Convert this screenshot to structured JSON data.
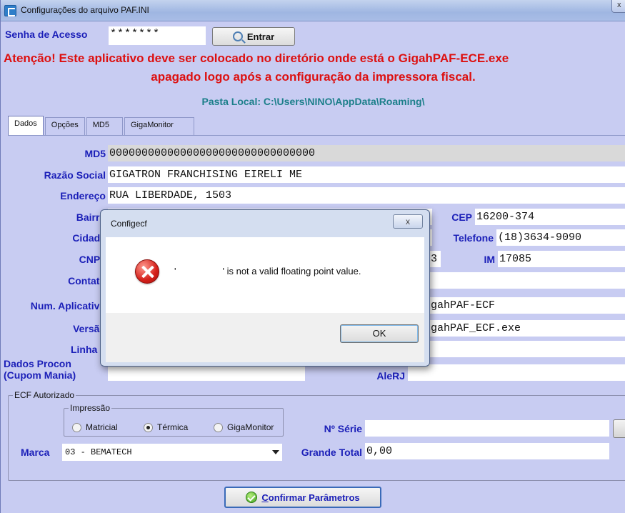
{
  "window": {
    "title": "Configurações do arquivo PAF.INI",
    "close_glyph": "x"
  },
  "login": {
    "label": "Senha de Acesso",
    "password_value": "*******",
    "enter_label": "Entrar"
  },
  "warning": {
    "line1": "Atenção! Este aplicativo deve ser colocado no diretório onde está o GigahPAF-ECE.exe",
    "line2": "apagado logo após a configuração da impressora fiscal."
  },
  "local_path": "Pasta Local: C:\\Users\\NINO\\AppData\\Roaming\\",
  "tabs": [
    {
      "label": "Dados",
      "active": true
    },
    {
      "label": "Opções",
      "active": false
    },
    {
      "label": "MD5",
      "active": false
    },
    {
      "label": "GigaMonitor",
      "active": false
    }
  ],
  "form": {
    "md5": {
      "label": "MD5",
      "value": "00000000000000000000000000000000"
    },
    "razao_social": {
      "label": "Razão Social",
      "value": "GIGATRON FRANCHISING EIRELI ME"
    },
    "endereco": {
      "label": "Endereço",
      "value": "RUA LIBERDADE, 1503"
    },
    "bairro": {
      "label": "Bairro"
    },
    "cep": {
      "label": "CEP",
      "value": "16200-374"
    },
    "cidade": {
      "label": "Cidade"
    },
    "telefone": {
      "label": "Telefone",
      "value": "(18)3634-9090"
    },
    "cnpj": {
      "label": "CNPJ",
      "partial_value": "3"
    },
    "im": {
      "label": "IM",
      "value": "17085"
    },
    "contato": {
      "label": "Contato"
    },
    "num_aplicativo": {
      "label": "Num. Aplicativo",
      "partial_value": "gahPAF-ECF"
    },
    "versao": {
      "label": "Versão",
      "partial_value": "gahPAF_ECF.exe"
    },
    "linha1": {
      "label": "Linha 1"
    },
    "procon": {
      "label_line1": "Dados Procon",
      "label_line2": "(Cupom Mania)"
    },
    "alerj": {
      "label": "AleRJ"
    }
  },
  "ecf": {
    "group_title": "ECF Autorizado",
    "impressao_title": "Impressão",
    "radios": [
      {
        "label": "Matricial",
        "checked": false
      },
      {
        "label": "Térmica",
        "checked": true
      },
      {
        "label": "GigaMonitor",
        "checked": false
      }
    ],
    "serie_label": "Nº Série",
    "serie_value": "",
    "marca_label": "Marca",
    "marca_value": "03 - BEMATECH",
    "grande_total_label": "Grande Total",
    "grande_total_value": "0,00"
  },
  "confirm": {
    "label_first": "C",
    "label_rest": "onfirmar Parâmetros"
  },
  "dialog": {
    "title": "Configecf",
    "close_glyph": "x",
    "message": "'                  ' is not a valid floating point value.",
    "ok_label": "OK"
  }
}
